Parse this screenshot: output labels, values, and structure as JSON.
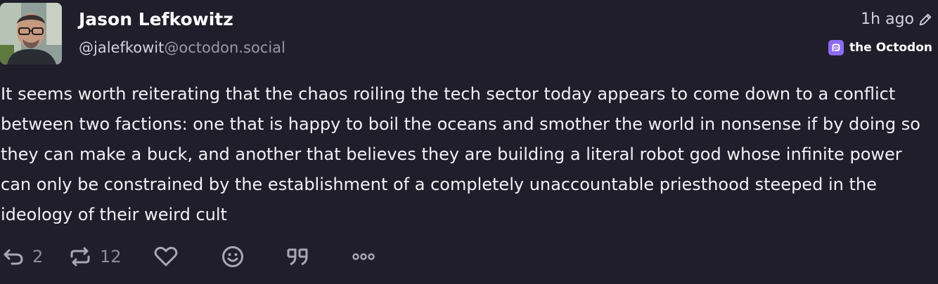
{
  "author": {
    "display_name": "Jason Lefkowitz",
    "handle_user": "@jalefkowit",
    "handle_domain": "@octodon.social"
  },
  "meta": {
    "time": "1h ago",
    "edited_icon": "pencil-icon",
    "instance_name": "the Octodon",
    "instance_icon": "mastodon-icon"
  },
  "content": "It seems worth reiterating that the chaos roiling the tech sector today appears to come down to a conflict between two factions: one that is happy to boil the oceans and smother the world in nonsense if by doing so they can make a buck, and another that believes they are building a literal robot god whose infinite power can only be constrained by the establishment of a completely unaccountable priesthood steeped in the ideology of their weird cult",
  "actions": {
    "reply_count": "2",
    "boost_count": "12",
    "icons": [
      "reply-icon",
      "boost-icon",
      "favourite-icon",
      "emoji-reaction-icon",
      "quote-icon",
      "more-icon"
    ]
  },
  "colors": {
    "background": "#201e2b",
    "accent": "#8c6cf2",
    "muted": "#9a97a9"
  }
}
